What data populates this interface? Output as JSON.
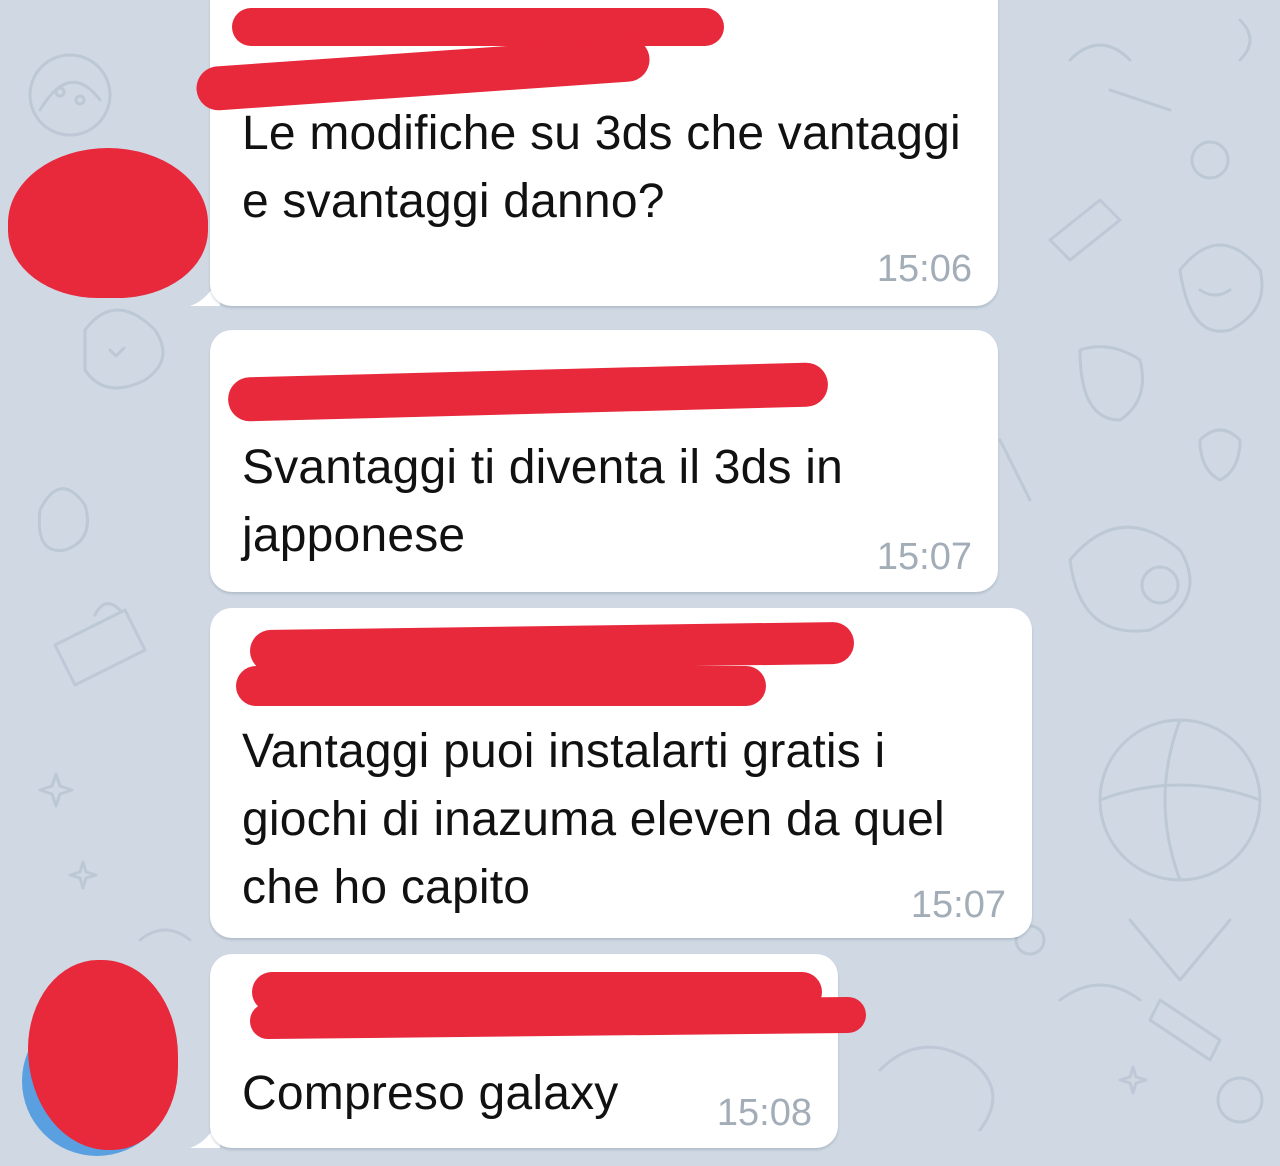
{
  "chat": {
    "messages": [
      {
        "text": "Le modifiche su 3ds che vantaggi e svantaggi danno?",
        "time": "15:06",
        "sender_redacted": true,
        "avatar_redacted": true
      },
      {
        "text": "Svantaggi ti diventa il 3ds in japponese",
        "time": "15:07",
        "sender_redacted": true,
        "avatar_redacted": false
      },
      {
        "text": "Vantaggi puoi instalarti gratis i giochi di inazuma eleven da quel che ho capito",
        "time": "15:07",
        "sender_redacted": true,
        "avatar_redacted": false
      },
      {
        "text": "Compreso galaxy",
        "time": "15:08",
        "sender_redacted": true,
        "avatar_redacted": true
      }
    ]
  },
  "colors": {
    "wallpaper": "#cfd8e3",
    "bubble": "#ffffff",
    "time_text": "#a3adb8",
    "sender_name": "#4f8fd1",
    "redaction": "#e8283b",
    "avatar": "#5a9fe0"
  }
}
